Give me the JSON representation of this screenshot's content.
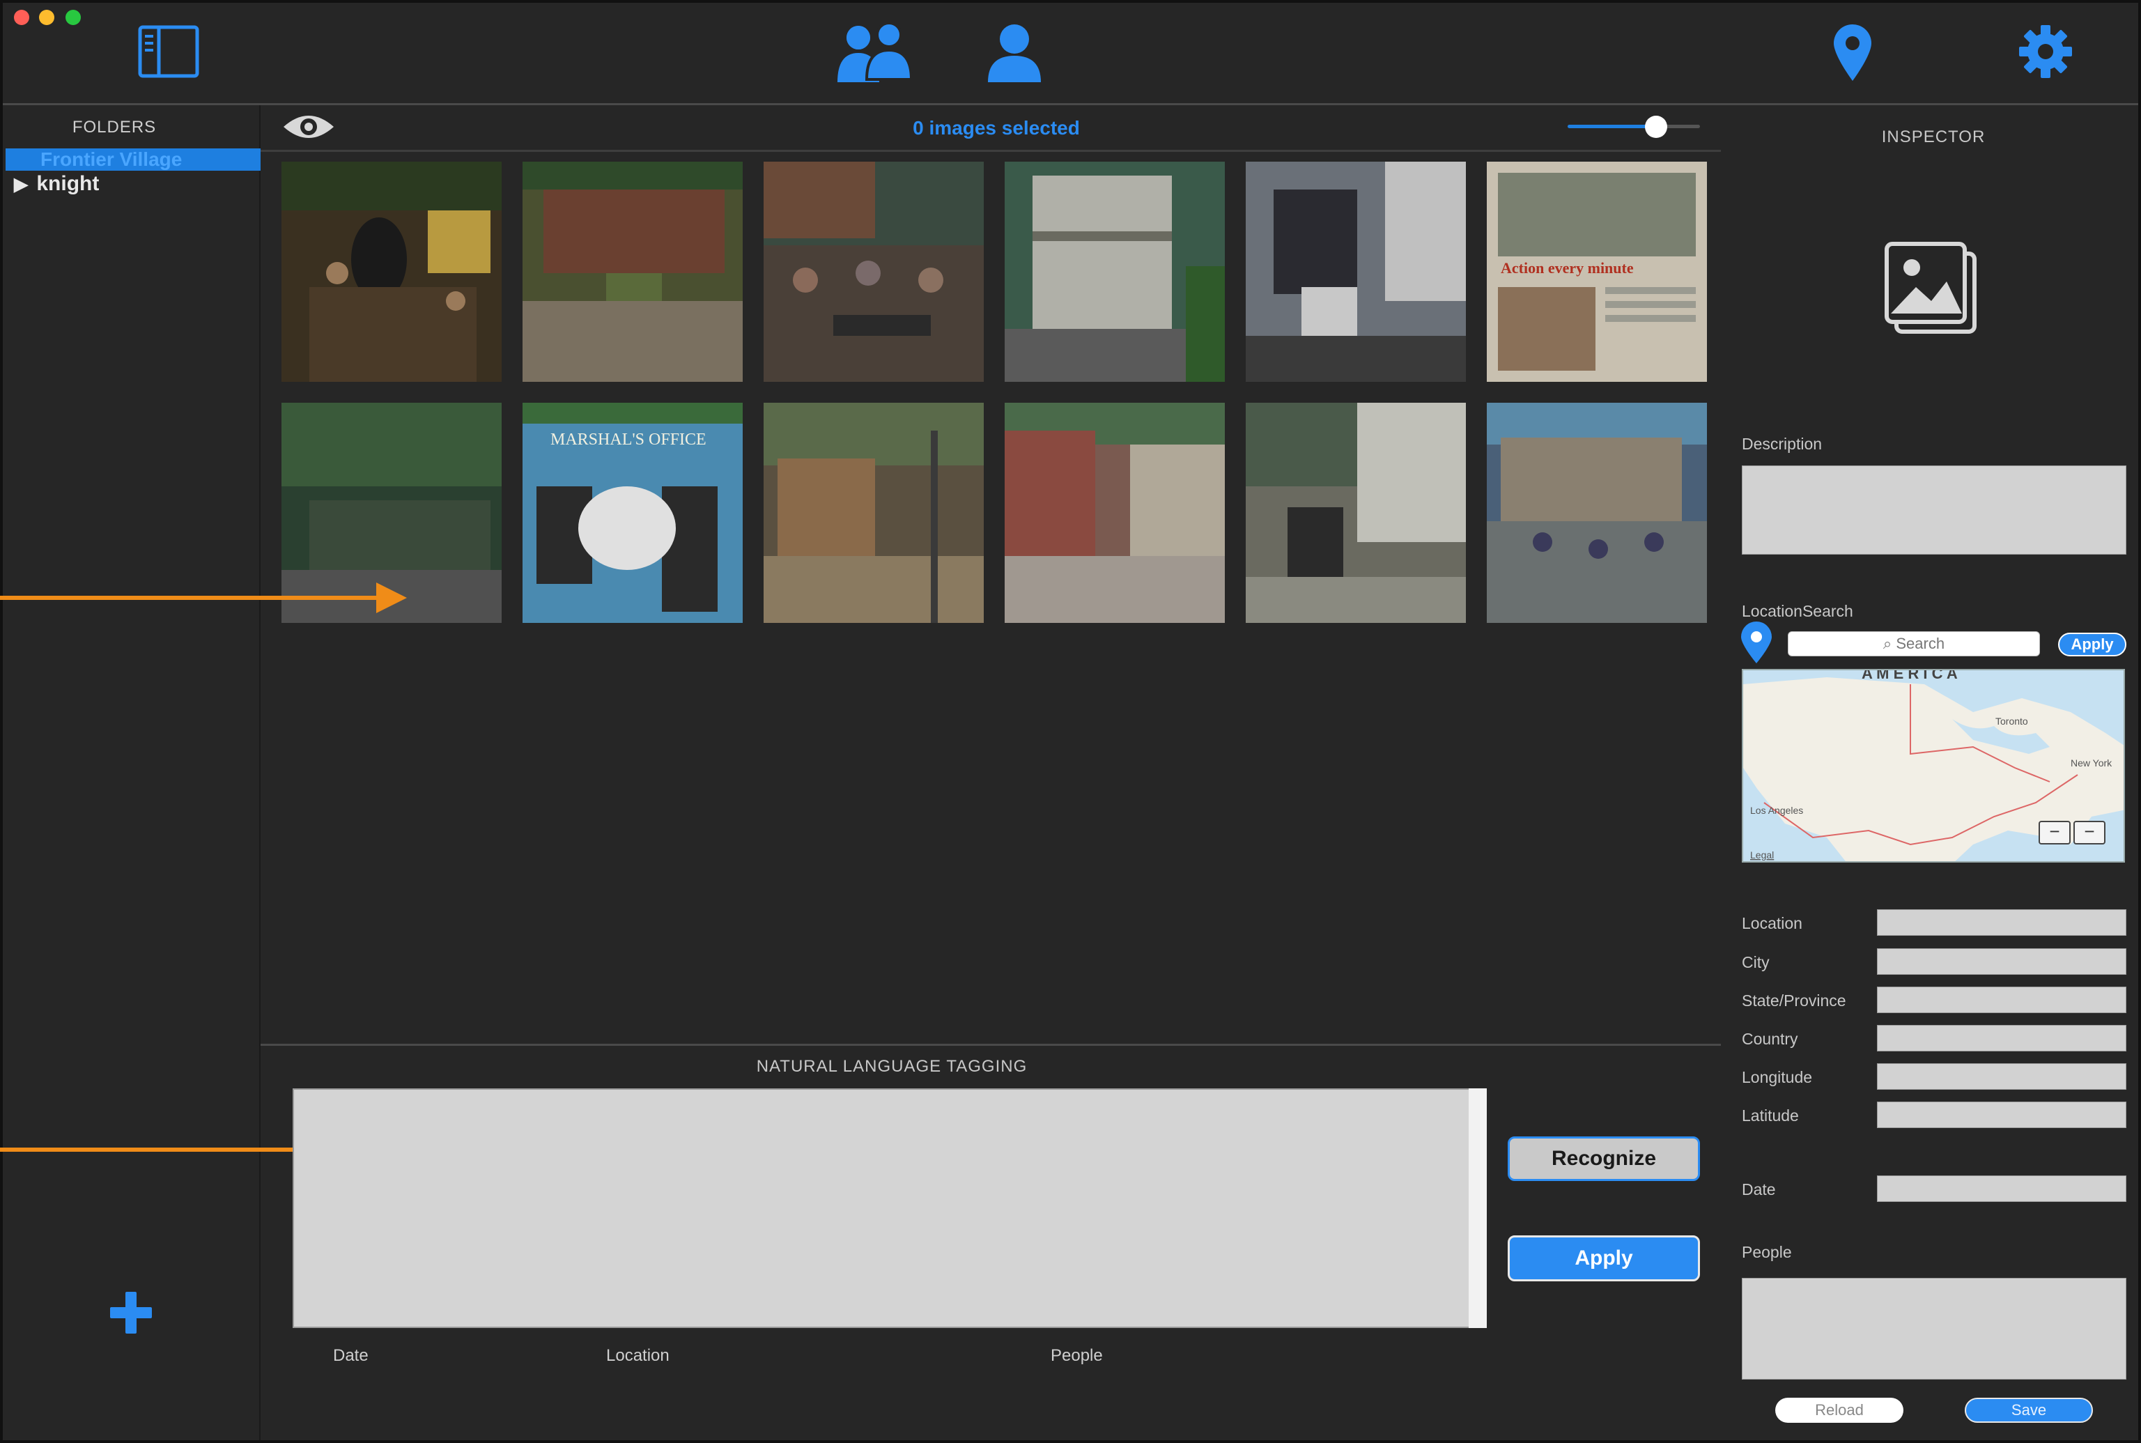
{
  "colors": {
    "accent": "#2b8cf2",
    "background": "#262626",
    "arrow": "#f08c18",
    "close": "#ff5f57",
    "minimize": "#febc2e",
    "zoom": "#28c840"
  },
  "toolbar": {
    "icons": [
      "sidebar-toggle-icon",
      "people-group-icon",
      "person-icon",
      "location-pin-icon",
      "gear-icon"
    ]
  },
  "sidebar": {
    "header": "FOLDERS",
    "items": [
      {
        "label": "Frontier Village",
        "selected": true
      },
      {
        "label": "knight",
        "selected": false
      }
    ]
  },
  "browser": {
    "selected_count": "0 images selected",
    "thumbnail_size": 0.7,
    "images": [
      {
        "caption": ""
      },
      {
        "caption": ""
      },
      {
        "caption": ""
      },
      {
        "caption": ""
      },
      {
        "caption": ""
      },
      {
        "caption": "Action every minute"
      },
      {
        "caption": ""
      },
      {
        "caption": "MARSHAL'S OFFICE"
      },
      {
        "caption": ""
      },
      {
        "caption": ""
      },
      {
        "caption": ""
      },
      {
        "caption": ""
      }
    ]
  },
  "tagging": {
    "title": "NATURAL LANGUAGE TAGGING",
    "text": "",
    "columns": [
      "Date",
      "Location",
      "People"
    ],
    "recognize_label": "Recognize",
    "apply_label": "Apply"
  },
  "inspector": {
    "title": "INSPECTOR",
    "description_label": "Description",
    "location_search_label": "LocationSearch",
    "search_placeholder": "Search",
    "search_apply_label": "Apply",
    "map": {
      "region_label": "A M E R I C A",
      "city_labels": [
        "Toronto",
        "Los Angeles",
        "New York"
      ],
      "legal": "Legal"
    },
    "fields": [
      {
        "label": "Location",
        "value": ""
      },
      {
        "label": "City",
        "value": ""
      },
      {
        "label": "State/Province",
        "value": ""
      },
      {
        "label": "Country",
        "value": ""
      },
      {
        "label": "Longitude",
        "value": ""
      },
      {
        "label": "Latitude",
        "value": ""
      }
    ],
    "date_label": "Date",
    "people_label": "People",
    "reload_label": "Reload",
    "save_label": "Save"
  }
}
